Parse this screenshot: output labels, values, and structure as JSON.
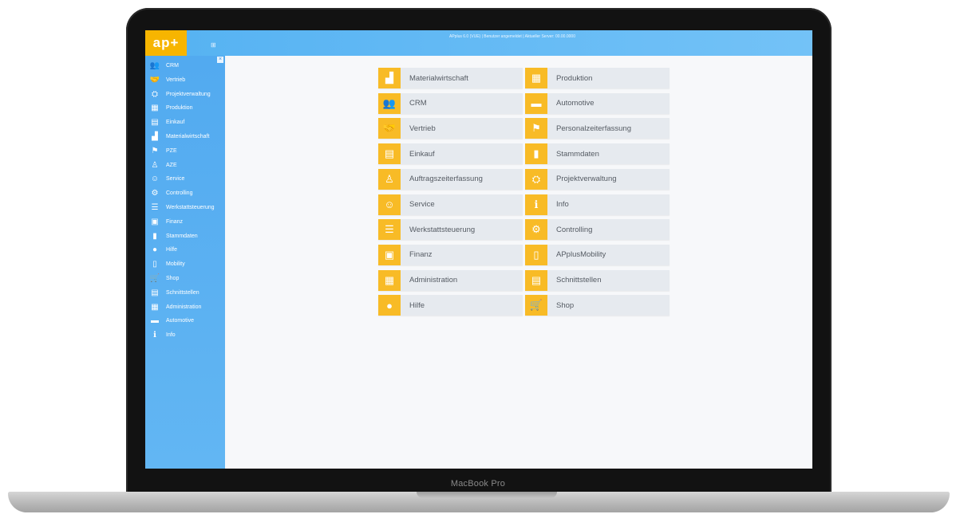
{
  "device": {
    "brand_label": "MacBook Pro"
  },
  "header": {
    "logo": "ap+",
    "status": "APplus 6.0 (VUE) | Benutzer angemeldet | Aktueller Server: 00.00.0000",
    "menu_icon": "menu-icon"
  },
  "sidebar": {
    "close_glyph": "×",
    "items": [
      {
        "label": "CRM",
        "icon": "crm-icon",
        "glyph": "👥"
      },
      {
        "label": "Vertrieb",
        "icon": "handshake-icon",
        "glyph": "🤝"
      },
      {
        "label": "Projektverwaltung",
        "icon": "project-icon",
        "glyph": "⛭"
      },
      {
        "label": "Produktion",
        "icon": "factory-icon",
        "glyph": "▦"
      },
      {
        "label": "Einkauf",
        "icon": "cart-icon",
        "glyph": "▤"
      },
      {
        "label": "Materialwirtschaft",
        "icon": "material-icon",
        "glyph": "▟"
      },
      {
        "label": "PZE",
        "icon": "time-icon",
        "glyph": "⚑"
      },
      {
        "label": "AZE",
        "icon": "person-time-icon",
        "glyph": "♙"
      },
      {
        "label": "Service",
        "icon": "service-icon",
        "glyph": "☺"
      },
      {
        "label": "Controlling",
        "icon": "controlling-icon",
        "glyph": "⚙"
      },
      {
        "label": "Werkstattsteuerung",
        "icon": "workshop-icon",
        "glyph": "☰"
      },
      {
        "label": "Finanz",
        "icon": "finance-icon",
        "glyph": "▣"
      },
      {
        "label": "Stammdaten",
        "icon": "master-data-icon",
        "glyph": "▮"
      },
      {
        "label": "Hilfe",
        "icon": "lightbulb-icon",
        "glyph": "●"
      },
      {
        "label": "Mobility",
        "icon": "mobile-icon",
        "glyph": "▯"
      },
      {
        "label": "Shop",
        "icon": "shop-cart-icon",
        "glyph": "🛒"
      },
      {
        "label": "Schnittstellen",
        "icon": "interface-icon",
        "glyph": "▤"
      },
      {
        "label": "Administration",
        "icon": "admin-icon",
        "glyph": "▦"
      },
      {
        "label": "Automotive",
        "icon": "car-icon",
        "glyph": "▬"
      },
      {
        "label": "Info",
        "icon": "info-icon",
        "glyph": "ℹ"
      }
    ]
  },
  "tiles": {
    "left": [
      {
        "label": "Materialwirtschaft",
        "icon": "material-icon",
        "glyph": "▟"
      },
      {
        "label": "CRM",
        "icon": "crm-icon",
        "glyph": "👥"
      },
      {
        "label": "Vertrieb",
        "icon": "handshake-icon",
        "glyph": "🤝"
      },
      {
        "label": "Einkauf",
        "icon": "cart-icon",
        "glyph": "▤"
      },
      {
        "label": "Auftragszeiterfassung",
        "icon": "person-time-icon",
        "glyph": "♙"
      },
      {
        "label": "Service",
        "icon": "service-icon",
        "glyph": "☺"
      },
      {
        "label": "Werkstattsteuerung",
        "icon": "workshop-icon",
        "glyph": "☰"
      },
      {
        "label": "Finanz",
        "icon": "finance-icon",
        "glyph": "▣"
      },
      {
        "label": "Administration",
        "icon": "admin-icon",
        "glyph": "▦"
      },
      {
        "label": "Hilfe",
        "icon": "lightbulb-icon",
        "glyph": "●"
      }
    ],
    "right": [
      {
        "label": "Produktion",
        "icon": "factory-icon",
        "glyph": "▦"
      },
      {
        "label": "Automotive",
        "icon": "car-icon",
        "glyph": "▬"
      },
      {
        "label": "Personalzeiterfassung",
        "icon": "time-icon",
        "glyph": "⚑"
      },
      {
        "label": "Stammdaten",
        "icon": "master-data-icon",
        "glyph": "▮"
      },
      {
        "label": "Projektverwaltung",
        "icon": "project-icon",
        "glyph": "⛭"
      },
      {
        "label": "Info",
        "icon": "info-icon",
        "glyph": "ℹ"
      },
      {
        "label": "Controlling",
        "icon": "controlling-icon",
        "glyph": "⚙"
      },
      {
        "label": "APplusMobility",
        "icon": "mobile-icon",
        "glyph": "▯"
      },
      {
        "label": "Schnittstellen",
        "icon": "interface-icon",
        "glyph": "▤"
      },
      {
        "label": "Shop",
        "icon": "shop-cart-icon",
        "glyph": "🛒"
      }
    ]
  },
  "colors": {
    "accent": "#f8bb26",
    "sidebar": "#52aaf0",
    "topbar": "#5ab4f3",
    "tile_bg": "#e6eaef"
  }
}
